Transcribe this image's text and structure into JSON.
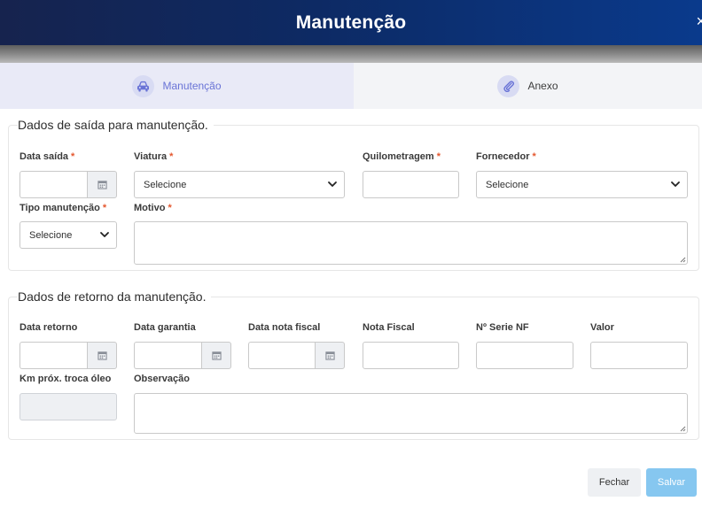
{
  "header": {
    "title": "Manutenção",
    "close_glyph": "×"
  },
  "tabs": [
    {
      "label": "Manutenção",
      "icon": "car-icon",
      "active": true
    },
    {
      "label": "Anexo",
      "icon": "paperclip-icon",
      "active": false
    }
  ],
  "section_saida": {
    "legend": "Dados de saída para manutenção.",
    "fields": {
      "data_saida": {
        "label": "Data saída",
        "required": "*"
      },
      "viatura": {
        "label": "Viatura",
        "required": "*",
        "value": "Selecione"
      },
      "quilometragem": {
        "label": "Quilometragem",
        "required": "*"
      },
      "fornecedor": {
        "label": "Fornecedor",
        "required": "*",
        "value": "Selecione"
      },
      "tipo_manutencao": {
        "label": "Tipo manutenção",
        "required": "*",
        "value": "Selecione"
      },
      "motivo": {
        "label": "Motivo",
        "required": "*"
      }
    }
  },
  "section_retorno": {
    "legend": "Dados de retorno da manutenção.",
    "fields": {
      "data_retorno": {
        "label": "Data retorno"
      },
      "data_garantia": {
        "label": "Data garantia"
      },
      "data_nota_fiscal": {
        "label": "Data nota fiscal"
      },
      "nota_fiscal": {
        "label": "Nota Fiscal"
      },
      "serie_nf": {
        "label": "Nº Serie NF"
      },
      "valor": {
        "label": "Valor"
      },
      "km_proxima_troca": {
        "label": "Km próx. troca óleo"
      },
      "observacao": {
        "label": "Observação"
      }
    }
  },
  "footer": {
    "close_label": "Fechar",
    "save_label": "Salvar"
  },
  "colors": {
    "header_start": "#16234e",
    "header_end": "#0a3a8c",
    "accent": "#6973d6",
    "required": "#e4572e",
    "save_button": "#86c7f0"
  }
}
